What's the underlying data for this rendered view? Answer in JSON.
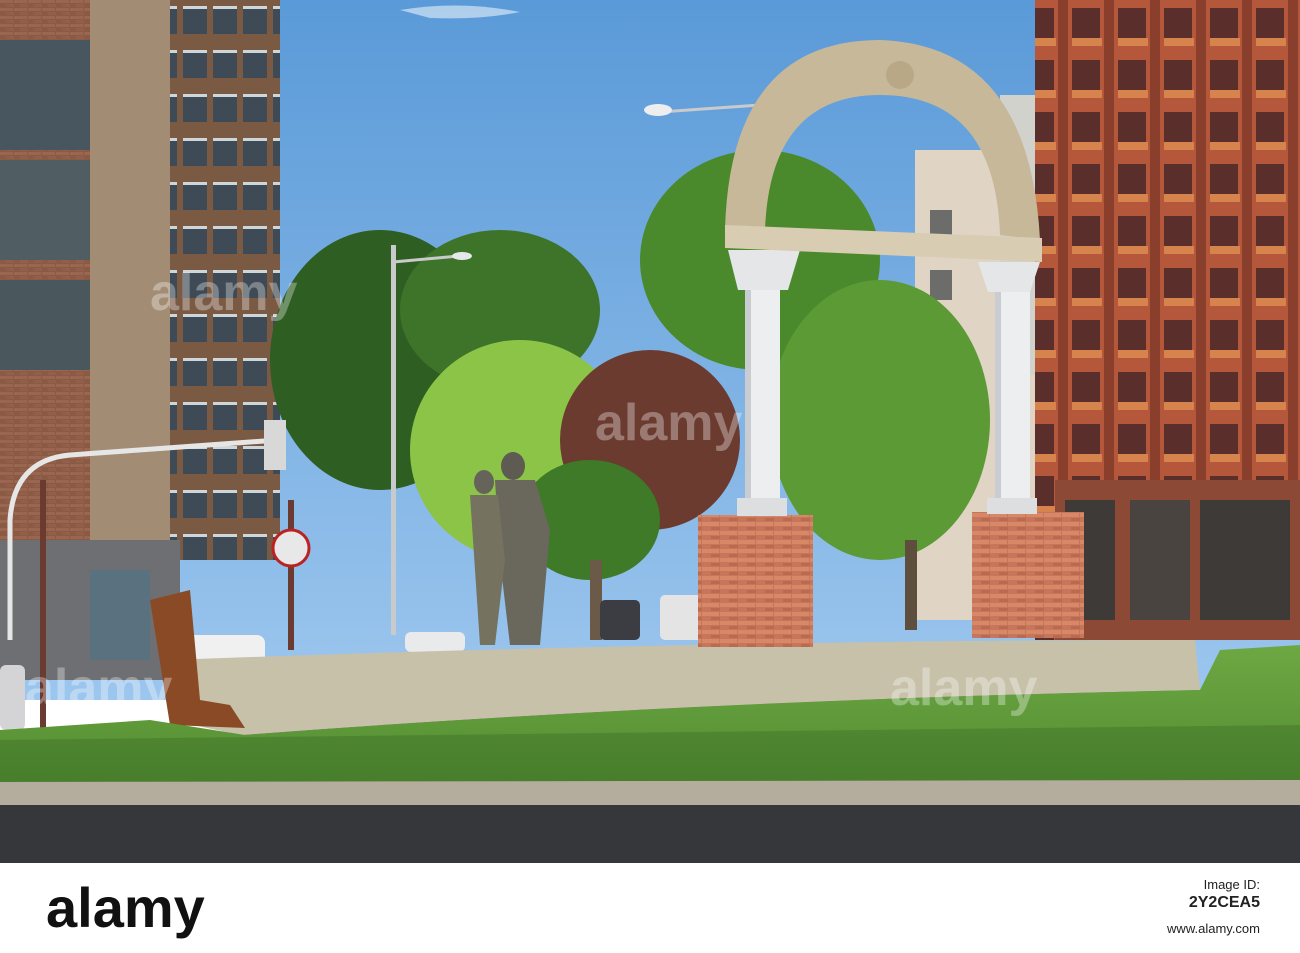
{
  "photo": {
    "subject": "Roundabout with a stone arch on two columns and a bronze statue group",
    "sky_color": "#6ba6e0",
    "grass_color": "#5f9a3a",
    "road_color": "#3a3c40"
  },
  "watermark": {
    "text": "alamy"
  },
  "footer": {
    "brand_text": "alamy",
    "image_id_label": "Image ID:",
    "image_id": "2Y2CEA5",
    "url": "www.alamy.com"
  }
}
